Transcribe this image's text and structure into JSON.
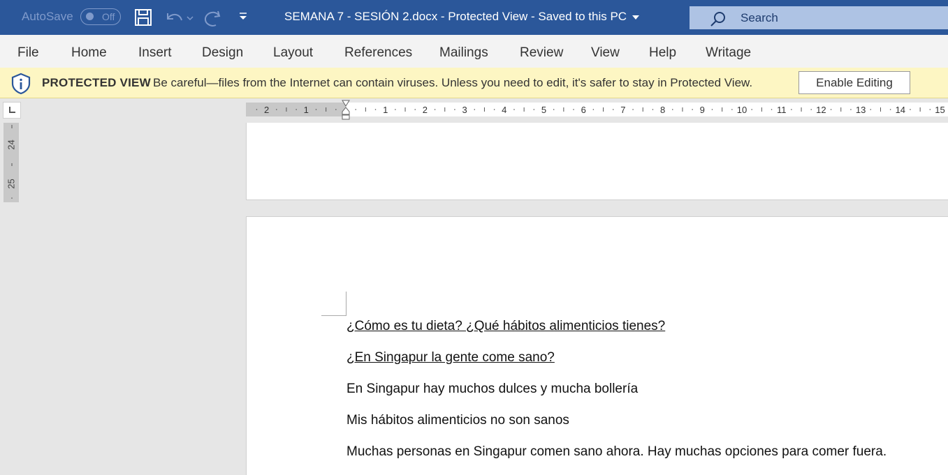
{
  "titlebar": {
    "autosave_label": "AutoSave",
    "autosave_state": "Off",
    "title": "SEMANA 7 - SESIÓN 2.docx  -  Protected View  -  Saved to this PC",
    "search_label": "Search",
    "icons": [
      "save-icon",
      "undo-icon",
      "redo-icon",
      "customize-qat-icon",
      "search-icon"
    ]
  },
  "menu": {
    "items": [
      "File",
      "Home",
      "Insert",
      "Design",
      "Layout",
      "References",
      "Mailings",
      "Review",
      "View",
      "Help",
      "Writage"
    ]
  },
  "protected_view": {
    "title": "PROTECTED VIEW",
    "message": "Be careful—files from the Internet can contain viruses. Unless you need to edit, it's safer to stay in Protected View.",
    "button": "Enable Editing"
  },
  "ruler": {
    "left_numbers": [
      "2",
      "1"
    ],
    "right_numbers": [
      "1",
      "2",
      "3",
      "4",
      "5",
      "6",
      "7",
      "8",
      "9",
      "10",
      "11",
      "12",
      "13",
      "14",
      "15"
    ],
    "vertical_numbers": [
      "24",
      "25"
    ]
  },
  "document": {
    "paragraphs": [
      {
        "text": "¿Cómo es tu dieta? ¿Qué hábitos alimenticios tienes?",
        "underline": true
      },
      {
        "text": "¿En Singapur la gente come sano?",
        "underline": true
      },
      {
        "text": "En Singapur hay muchos dulces y mucha bollería",
        "underline": false
      },
      {
        "text": "Mis hábitos alimenticios no son sanos",
        "underline": false
      },
      {
        "text": "Muchas personas en Singapur comen sano ahora. Hay muchas opciones para comer fuera.",
        "underline": false
      }
    ]
  },
  "colors": {
    "titlebar": "#2b579a",
    "menubar": "#f3f3f3",
    "protected_bar": "#fdf6c3",
    "workspace": "#e6e6e6"
  }
}
